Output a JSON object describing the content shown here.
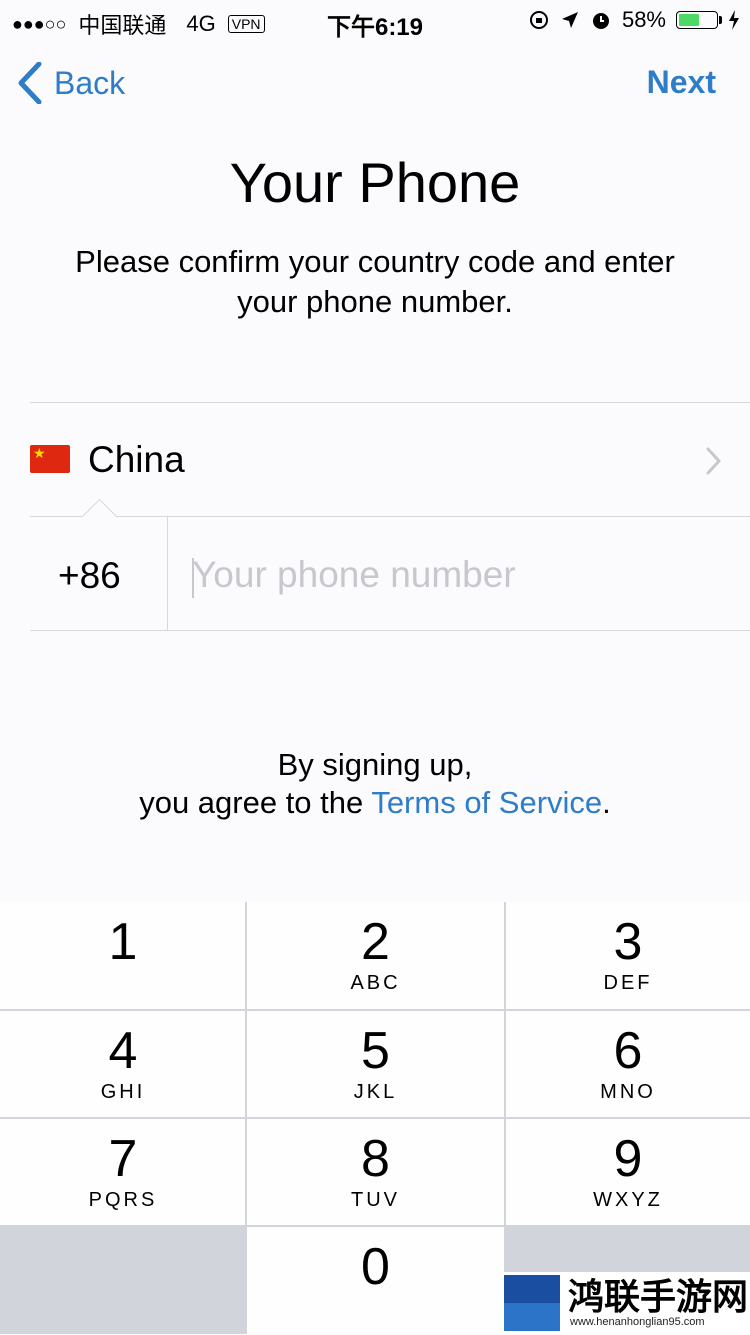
{
  "status_bar": {
    "signal": "●●●○○",
    "carrier": "中国联通",
    "network": "4G",
    "vpn": "VPN",
    "time": "下午6:19",
    "battery_percent": "58%",
    "battery_level": 0.58,
    "battery_color": "#4cd964"
  },
  "nav": {
    "back_label": "Back",
    "next_label": "Next",
    "accent": "#2f7cc8"
  },
  "title": "Your Phone",
  "subtitle": "Please confirm your country code and enter your phone number.",
  "country": {
    "name": "China",
    "flag": "flag-cn-icon",
    "code": "+86"
  },
  "phone": {
    "placeholder": "Your phone number",
    "value": ""
  },
  "terms": {
    "line1": "By signing up,",
    "line2_prefix": "you agree to the ",
    "link": "Terms of Service",
    "line2_suffix": "."
  },
  "keypad": {
    "keys": [
      {
        "digit": "1",
        "letters": ""
      },
      {
        "digit": "2",
        "letters": "ABC"
      },
      {
        "digit": "3",
        "letters": "DEF"
      },
      {
        "digit": "4",
        "letters": "GHI"
      },
      {
        "digit": "5",
        "letters": "JKL"
      },
      {
        "digit": "6",
        "letters": "MNO"
      },
      {
        "digit": "7",
        "letters": "PQRS"
      },
      {
        "digit": "8",
        "letters": "TUV"
      },
      {
        "digit": "9",
        "letters": "WXYZ"
      },
      {
        "digit": "0",
        "letters": ""
      }
    ]
  },
  "watermark": {
    "title": "鸿联手游网",
    "url": "www.henanhonglian95.com"
  }
}
